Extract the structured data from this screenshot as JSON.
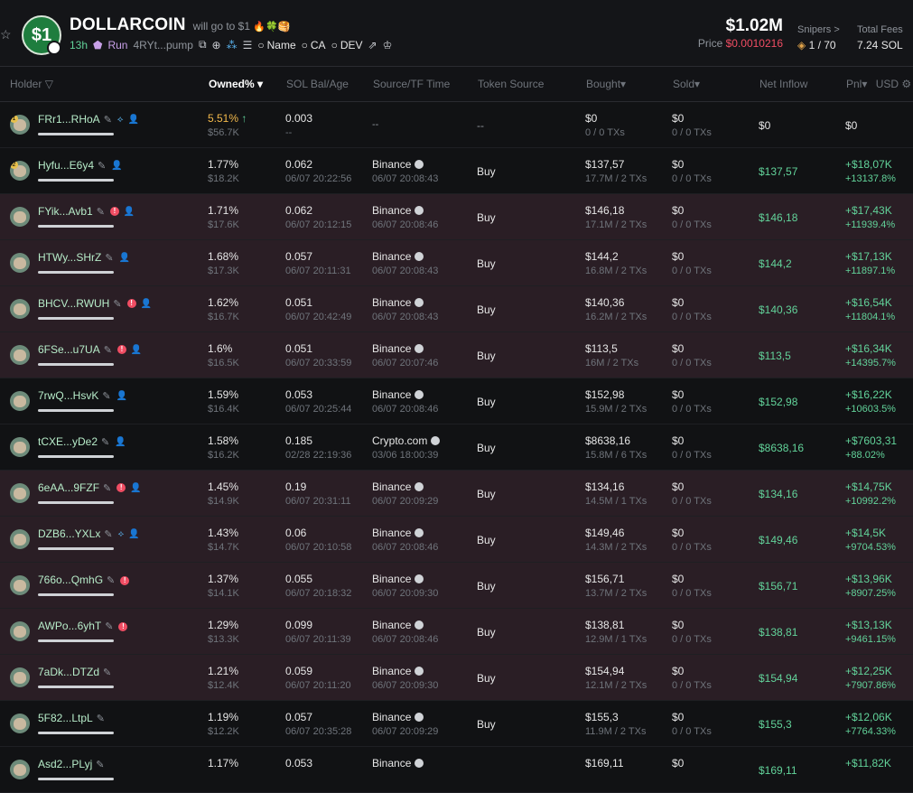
{
  "header": {
    "title": "DOLLARCOIN",
    "logo_text": "$1",
    "tagline": "will go to $1",
    "age": "13h",
    "run_label": "Run",
    "contract_short": "4RYt...pump",
    "search_links": [
      "Name",
      "CA",
      "DEV"
    ],
    "market_cap": "$1.02M",
    "price_label": "Price",
    "price_value": "$0.0010216",
    "snipers_label": "Snipers >",
    "snipers_value": "1 / 70",
    "fees_label": "Total Fees",
    "fees_value": "7.24 SOL",
    "accent_green": "#62d39a",
    "accent_red": "#f04d63"
  },
  "columns": {
    "holder": "Holder",
    "owned": "Owned%",
    "sol": "SOL Bal/Age",
    "source": "Source/TF Time",
    "token_source": "Token Source",
    "bought": "Bought",
    "sold": "Sold",
    "inflow": "Net Inflow",
    "pnl": "Pnl",
    "currency": "USD"
  },
  "rows": [
    {
      "rank": "1",
      "addr": "FRr1...RHoA",
      "owned": "5.51%",
      "owned_usd": "$56.7K",
      "sol": "0.003",
      "age": "--",
      "source": "--",
      "source_time": "",
      "token_source": "--",
      "bought": "$0",
      "bought_sub": "0 / 0 TXs",
      "sold": "$0",
      "sold_sub": "0 / 0 TXs",
      "inflow": "$0",
      "pnl": "$0",
      "pnl_pct": ""
    },
    {
      "rank": "2",
      "addr": "Hyfu...E6y4",
      "owned": "1.77%",
      "owned_usd": "$18.2K",
      "sol": "0.062",
      "age": "06/07 20:22:56",
      "source": "Binance",
      "source_time": "06/07 20:08:43",
      "token_source": "Buy",
      "bought": "$137,57",
      "bought_sub": "17.7M / 2 TXs",
      "sold": "$0",
      "sold_sub": "0 / 0 TXs",
      "inflow": "$137,57",
      "pnl": "+$18,07K",
      "pnl_pct": "+13137.8%"
    },
    {
      "rank": "",
      "addr": "FYik...Avb1",
      "owned": "1.71%",
      "owned_usd": "$17.6K",
      "sol": "0.062",
      "age": "06/07 20:12:15",
      "source": "Binance",
      "source_time": "06/07 20:08:46",
      "token_source": "Buy",
      "bought": "$146,18",
      "bought_sub": "17.1M / 2 TXs",
      "sold": "$0",
      "sold_sub": "0 / 0 TXs",
      "inflow": "$146,18",
      "pnl": "+$17,43K",
      "pnl_pct": "+11939.4%"
    },
    {
      "rank": "",
      "addr": "HTWy...SHrZ",
      "owned": "1.68%",
      "owned_usd": "$17.3K",
      "sol": "0.057",
      "age": "06/07 20:11:31",
      "source": "Binance",
      "source_time": "06/07 20:08:43",
      "token_source": "Buy",
      "bought": "$144,2",
      "bought_sub": "16.8M / 2 TXs",
      "sold": "$0",
      "sold_sub": "0 / 0 TXs",
      "inflow": "$144,2",
      "pnl": "+$17,13K",
      "pnl_pct": "+11897.1%"
    },
    {
      "rank": "",
      "addr": "BHCV...RWUH",
      "owned": "1.62%",
      "owned_usd": "$16.7K",
      "sol": "0.051",
      "age": "06/07 20:42:49",
      "source": "Binance",
      "source_time": "06/07 20:08:43",
      "token_source": "Buy",
      "bought": "$140,36",
      "bought_sub": "16.2M / 2 TXs",
      "sold": "$0",
      "sold_sub": "0 / 0 TXs",
      "inflow": "$140,36",
      "pnl": "+$16,54K",
      "pnl_pct": "+11804.1%"
    },
    {
      "rank": "",
      "addr": "6FSe...u7UA",
      "owned": "1.6%",
      "owned_usd": "$16.5K",
      "sol": "0.051",
      "age": "06/07 20:33:59",
      "source": "Binance",
      "source_time": "06/07 20:07:46",
      "token_source": "Buy",
      "bought": "$113,5",
      "bought_sub": "16M / 2 TXs",
      "sold": "$0",
      "sold_sub": "0 / 0 TXs",
      "inflow": "$113,5",
      "pnl": "+$16,34K",
      "pnl_pct": "+14395.7%"
    },
    {
      "rank": "",
      "addr": "7rwQ...HsvK",
      "owned": "1.59%",
      "owned_usd": "$16.4K",
      "sol": "0.053",
      "age": "06/07 20:25:44",
      "source": "Binance",
      "source_time": "06/07 20:08:46",
      "token_source": "Buy",
      "bought": "$152,98",
      "bought_sub": "15.9M / 2 TXs",
      "sold": "$0",
      "sold_sub": "0 / 0 TXs",
      "inflow": "$152,98",
      "pnl": "+$16,22K",
      "pnl_pct": "+10603.5%"
    },
    {
      "rank": "",
      "addr": "tCXE...yDe2",
      "owned": "1.58%",
      "owned_usd": "$16.2K",
      "sol": "0.185",
      "age": "02/28 22:19:36",
      "source": "Crypto.com",
      "source_time": "03/06 18:00:39",
      "token_source": "Buy",
      "bought": "$8638,16",
      "bought_sub": "15.8M / 6 TXs",
      "sold": "$0",
      "sold_sub": "0 / 0 TXs",
      "inflow": "$8638,16",
      "pnl": "+$7603,31",
      "pnl_pct": "+88.02%"
    },
    {
      "rank": "",
      "addr": "6eAA...9FZF",
      "owned": "1.45%",
      "owned_usd": "$14.9K",
      "sol": "0.19",
      "age": "06/07 20:31:11",
      "source": "Binance",
      "source_time": "06/07 20:09:29",
      "token_source": "Buy",
      "bought": "$134,16",
      "bought_sub": "14.5M / 1 TXs",
      "sold": "$0",
      "sold_sub": "0 / 0 TXs",
      "inflow": "$134,16",
      "pnl": "+$14,75K",
      "pnl_pct": "+10992.2%"
    },
    {
      "rank": "",
      "addr": "DZB6...YXLx",
      "owned": "1.43%",
      "owned_usd": "$14.7K",
      "sol": "0.06",
      "age": "06/07 20:10:58",
      "source": "Binance",
      "source_time": "06/07 20:08:46",
      "token_source": "Buy",
      "bought": "$149,46",
      "bought_sub": "14.3M / 2 TXs",
      "sold": "$0",
      "sold_sub": "0 / 0 TXs",
      "inflow": "$149,46",
      "pnl": "+$14,5K",
      "pnl_pct": "+9704.53%"
    },
    {
      "rank": "",
      "addr": "766o...QmhG",
      "owned": "1.37%",
      "owned_usd": "$14.1K",
      "sol": "0.055",
      "age": "06/07 20:18:32",
      "source": "Binance",
      "source_time": "06/07 20:09:30",
      "token_source": "Buy",
      "bought": "$156,71",
      "bought_sub": "13.7M / 2 TXs",
      "sold": "$0",
      "sold_sub": "0 / 0 TXs",
      "inflow": "$156,71",
      "pnl": "+$13,96K",
      "pnl_pct": "+8907.25%"
    },
    {
      "rank": "",
      "addr": "AWPo...6yhT",
      "owned": "1.29%",
      "owned_usd": "$13.3K",
      "sol": "0.099",
      "age": "06/07 20:11:39",
      "source": "Binance",
      "source_time": "06/07 20:08:46",
      "token_source": "Buy",
      "bought": "$138,81",
      "bought_sub": "12.9M / 1 TXs",
      "sold": "$0",
      "sold_sub": "0 / 0 TXs",
      "inflow": "$138,81",
      "pnl": "+$13,13K",
      "pnl_pct": "+9461.15%"
    },
    {
      "rank": "",
      "addr": "7aDk...DTZd",
      "owned": "1.21%",
      "owned_usd": "$12.4K",
      "sol": "0.059",
      "age": "06/07 20:11:20",
      "source": "Binance",
      "source_time": "06/07 20:09:30",
      "token_source": "Buy",
      "bought": "$154,94",
      "bought_sub": "12.1M / 2 TXs",
      "sold": "$0",
      "sold_sub": "0 / 0 TXs",
      "inflow": "$154,94",
      "pnl": "+$12,25K",
      "pnl_pct": "+7907.86%"
    },
    {
      "rank": "",
      "addr": "5F82...LtpL",
      "owned": "1.19%",
      "owned_usd": "$12.2K",
      "sol": "0.057",
      "age": "06/07 20:35:28",
      "source": "Binance",
      "source_time": "06/07 20:09:29",
      "token_source": "Buy",
      "bought": "$155,3",
      "bought_sub": "11.9M / 2 TXs",
      "sold": "$0",
      "sold_sub": "0 / 0 TXs",
      "inflow": "$155,3",
      "pnl": "+$12,06K",
      "pnl_pct": "+7764.33%"
    },
    {
      "rank": "",
      "addr": "Asd2...PLyj",
      "owned": "1.17%",
      "owned_usd": "",
      "sol": "0.053",
      "age": "",
      "source": "Binance",
      "source_time": "",
      "token_source": "",
      "bought": "$169,11",
      "bought_sub": "",
      "sold": "$0",
      "sold_sub": "",
      "inflow": "$169,11",
      "pnl": "+$11,82K",
      "pnl_pct": ""
    }
  ]
}
